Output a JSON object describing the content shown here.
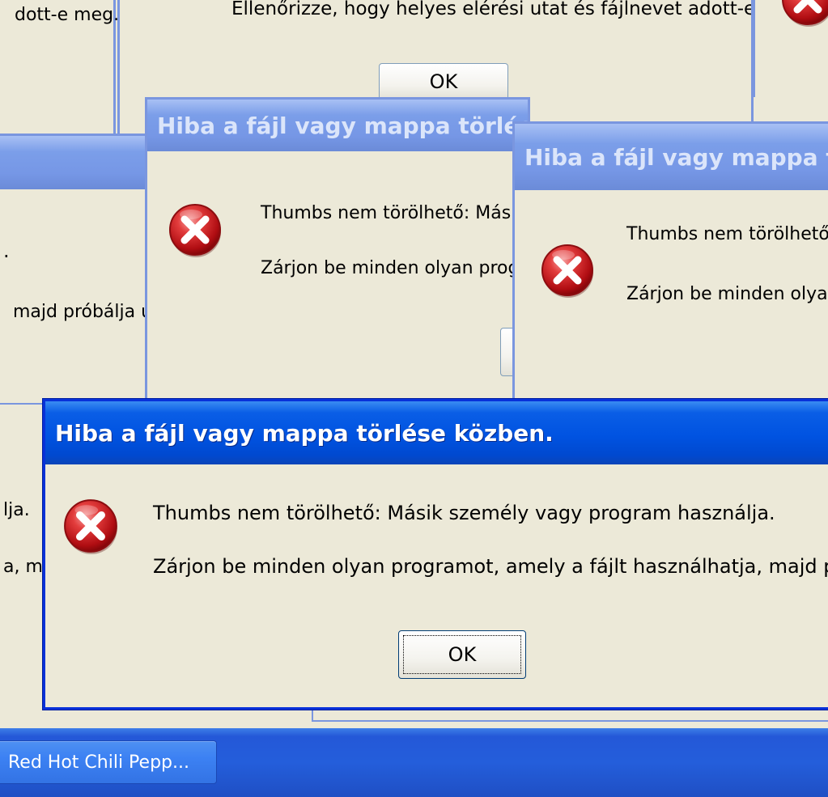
{
  "dialog_title": "Hiba a fájl vagy mappa törlése közben.",
  "message_line1": "Thumbs nem törölhető: Másik személy vagy program használja.",
  "message_line2": "Zárjon be minden olyan programot, amely a fájlt használhatja, majd próbálja újra.",
  "ok_label": "OK",
  "top_dialog": {
    "left_fragment": "dott-e meg.",
    "message": "Ellenőrizze, hogy helyes elérési utat és fájlnevet adott-e meg.",
    "ok_label": "OK"
  },
  "left_dialog": {
    "fragment1": ".",
    "fragment2": "majd próbálja ú"
  },
  "behind_front": {
    "fragment1": "lja.",
    "fragment2": "a, m"
  },
  "taskbar": {
    "task_label": "Red Hot Chili Pepp..."
  },
  "colors": {
    "dialog_face": "#ece9d8",
    "active_title": "#0053e1",
    "inactive_title": "#7697e6",
    "error_icon": "#c8141c",
    "taskbar": "#245edb"
  },
  "icons": {
    "error": "error-icon"
  }
}
